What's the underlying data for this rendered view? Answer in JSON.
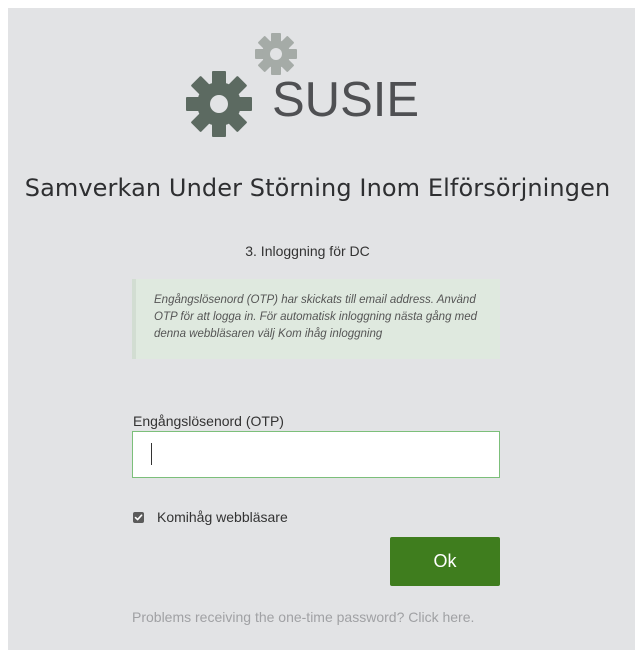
{
  "logo": {
    "text": "SUSIE",
    "gear_color": "#5c6a61",
    "text_color": "#4f5053"
  },
  "org_title": "Samverkan Under Störning Inom Elförsörjningen",
  "step_title": "3. Inloggning för DC",
  "info": {
    "message": "Engångslösenord (OTP) har skickats till email address. Använd OTP för att logga in. För automatisk inloggning nästa gång med denna webbläsaren välj Kom ihåg inloggning"
  },
  "otp": {
    "label": "Engångslösenord (OTP)",
    "value": ""
  },
  "remember": {
    "label": "Komihåg webbläsare",
    "checked": true
  },
  "ok_button": {
    "label": "Ok",
    "color": "#3f7d1e"
  },
  "problems_link": {
    "text": "Problems receiving the one-time password? Click here."
  }
}
